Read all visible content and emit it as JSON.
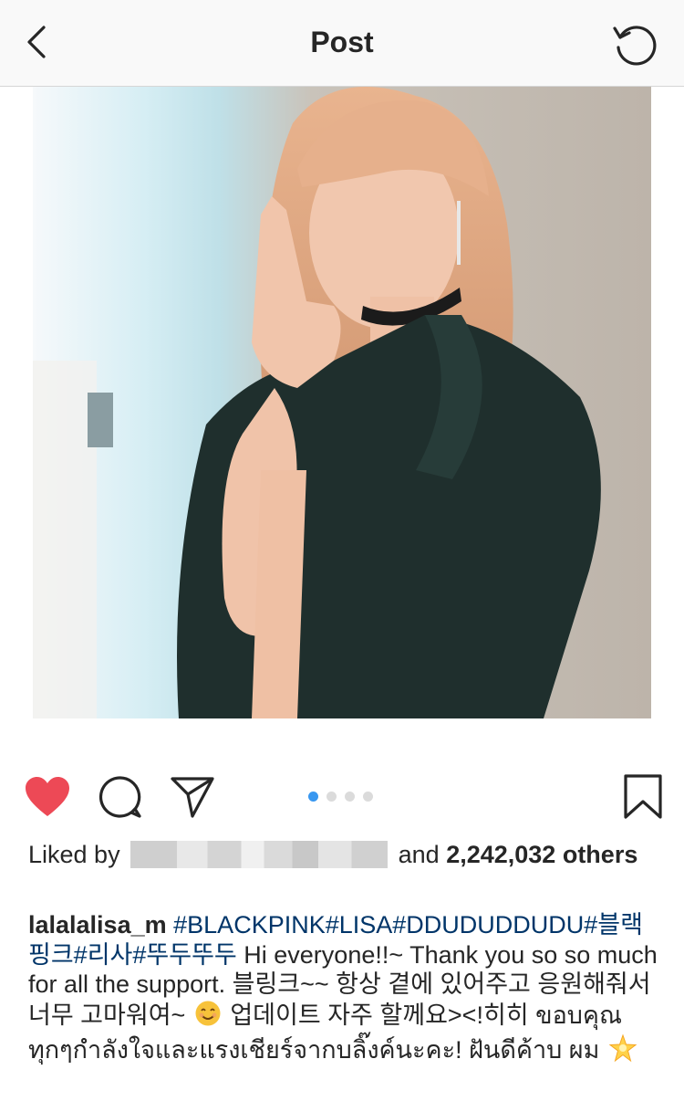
{
  "header": {
    "title": "Post"
  },
  "post": {
    "pagination": {
      "count": 4,
      "active": 0
    },
    "likes": {
      "prefix": "Liked by",
      "and": "and",
      "count": "2,242,032",
      "suffix": "others"
    },
    "caption": {
      "username": "lalalalisa_m",
      "hashtags": "#BLACKPINK#LISA#DDUDUDDUDU#블랙핑크#리사#뚜두뚜두",
      "text1": "Hi everyone!!~ Thank you so so much for all the support. 블링크~~ 항상 곁에 있어주고 응원해줘서 너무 고마워여~",
      "emoji1": "smiling-face-icon",
      "text2": "업데이트 자주 할께요><!히히 ขอบคุณทุกๆกำลังใจและแรงเชียร์จากบลิ๊งค์นะคะ! ฝันดีค้าบ ผม",
      "emoji2": "glowing-star-icon"
    }
  },
  "colors": {
    "like": "#ed4956",
    "hashtag": "#003569",
    "active_dot": "#3897f0"
  }
}
